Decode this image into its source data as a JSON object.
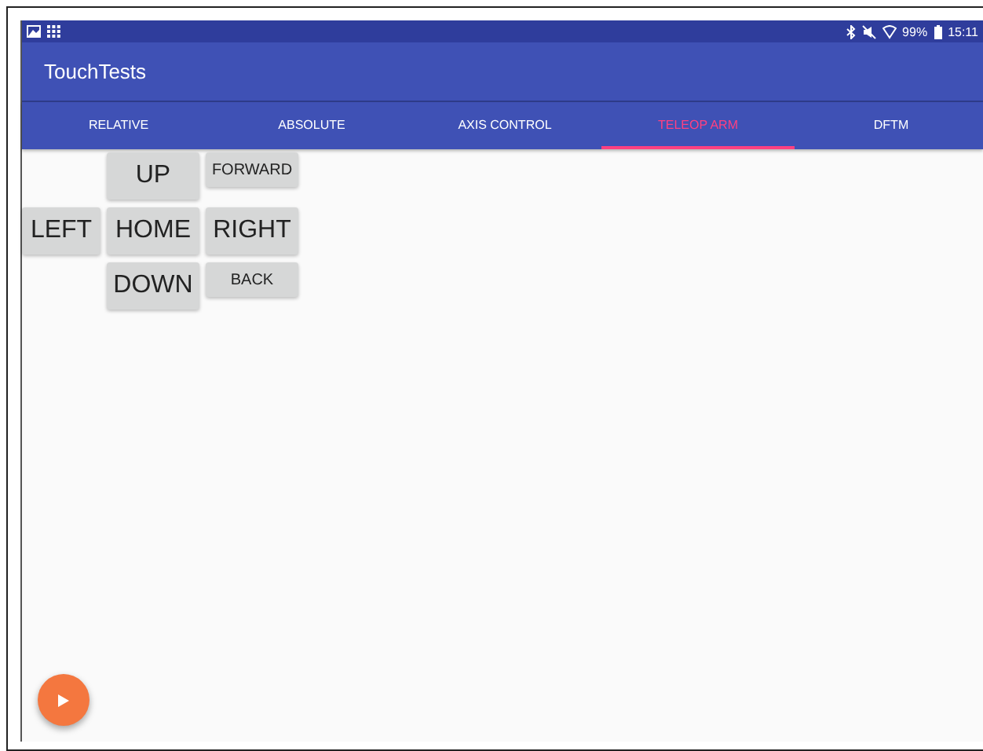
{
  "status_bar": {
    "battery": "99%",
    "time": "15:11"
  },
  "app_bar": {
    "title": "TouchTests"
  },
  "tabs": [
    {
      "label": "RELATIVE",
      "selected": false
    },
    {
      "label": "ABSOLUTE",
      "selected": false
    },
    {
      "label": "AXIS CONTROL",
      "selected": false
    },
    {
      "label": "TELEOP ARM",
      "selected": true
    },
    {
      "label": "DFTM",
      "selected": false
    }
  ],
  "buttons": [
    {
      "label": "UP",
      "kind": "large"
    },
    {
      "label": "FORWARD",
      "kind": "small"
    },
    {
      "label": "LEFT",
      "kind": "large"
    },
    {
      "label": "HOME",
      "kind": "large"
    },
    {
      "label": "RIGHT",
      "kind": "large"
    },
    {
      "label": "DOWN",
      "kind": "large"
    },
    {
      "label": "BACK",
      "kind": "small"
    }
  ],
  "fab": {
    "kind": "play"
  }
}
